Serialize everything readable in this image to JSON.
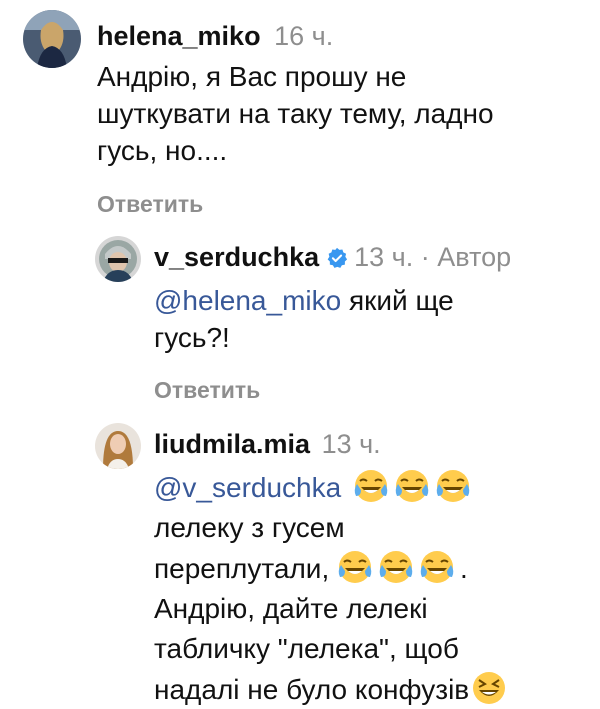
{
  "comments": [
    {
      "username": "helena_miko",
      "time": "16 ч.",
      "text": "Андрію, я Вас прошу не шуткувати на таку тему, ладно гусь, но....",
      "reply_label": "Ответить"
    },
    {
      "username": "v_serduchka",
      "verified": true,
      "time": "13 ч.",
      "separator": "·",
      "author_badge": "Автор",
      "mention": "@helena_miko",
      "text": " який ще гусь?!",
      "reply_label": "Ответить"
    },
    {
      "username": "liudmila.mia",
      "time": "13 ч.",
      "mention": "@v_serduchka",
      "line2": "лелеку з гусем",
      "line3": "переплутали, ",
      "line3_end": ".",
      "line4": "Андрію, дайте лелекі",
      "line5": "табличку \"лелека\", щоб",
      "line6": "надалі не було конфузів"
    }
  ],
  "icons": {
    "verified": "verified-badge-icon",
    "laugh": "face-with-tears-of-joy-emoji",
    "grin": "grinning-squinting-face-emoji"
  },
  "colors": {
    "mention": "#385898",
    "meta": "#8e8e8e",
    "verified": "#3897f0"
  }
}
